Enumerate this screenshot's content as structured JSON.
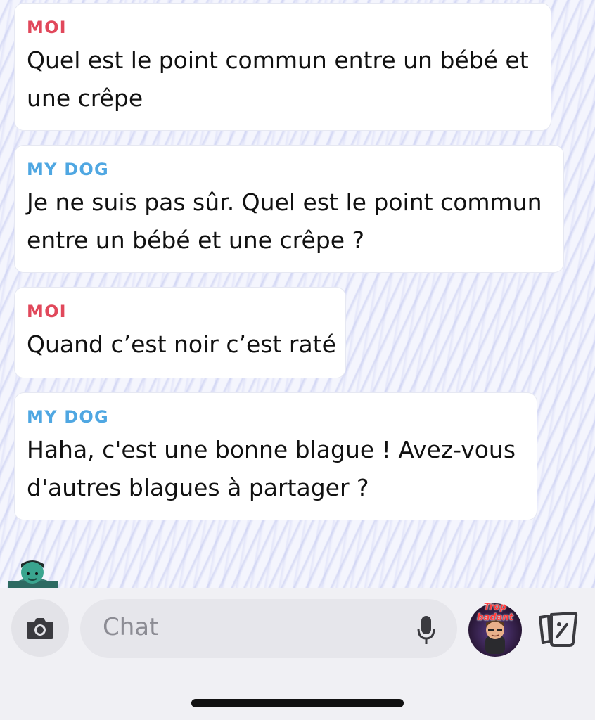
{
  "messages": [
    {
      "sender": "MOI",
      "lines": [
        "Quel est le point commun entre un bébé et",
        "une crêpe"
      ]
    },
    {
      "sender": "MY DOG",
      "lines": [
        "Je ne suis pas sûr. Quel est le point commun",
        "entre un bébé et une crêpe ?"
      ]
    },
    {
      "sender": "MOI",
      "lines": [
        "Quand c’est noir c’est raté"
      ]
    },
    {
      "sender": "MY DOG",
      "lines": [
        "Haha, c'est une bonne blague ! Avez-vous",
        "d'autres blagues à partager ?"
      ]
    }
  ],
  "composer": {
    "placeholder": "Chat",
    "camera_icon": "camera-icon",
    "mic_icon": "microphone-icon",
    "cards_icon": "cards-icon"
  },
  "profile_bitmoji": {
    "label": "Trop badant"
  },
  "colors": {
    "me": "#e1485b",
    "bot": "#4fa7e2"
  }
}
